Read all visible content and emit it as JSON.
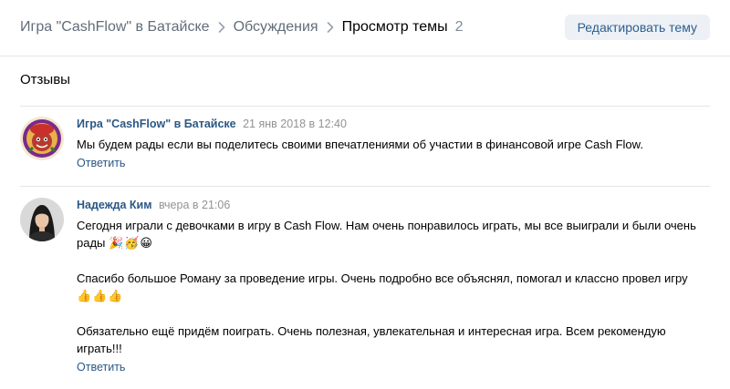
{
  "breadcrumb": {
    "group": "Игра \"CashFlow\" в Батайске",
    "section": "Обсуждения",
    "current": "Просмотр темы",
    "count": "2"
  },
  "header": {
    "edit_label": "Редактировать тему"
  },
  "topic": {
    "title": "Отзывы"
  },
  "posts": [
    {
      "author": "Игра \"CashFlow\" в Батайске",
      "date": "21 янв 2018 в 12:40",
      "paragraphs": [
        "Мы будем рады если вы поделитесь своими впечатлениями об участии в финансовой игре Cash Flow."
      ],
      "reply_label": "Ответить"
    },
    {
      "author": "Надежда Ким",
      "date": "вчера в 21:06",
      "paragraphs": [
        "Сегодня играли с девочками в игру в Cash Flow. Нам очень понравилось играть, мы все выиграли и были очень рады",
        "Спасибо большое Роману за проведение игры. Очень подробно все объяснял, помогал и классно провел игру",
        "Обязательно ещё придём поиграть. Очень полезная, увлекательная и интересная игра. Всем рекомендую играть!!!"
      ],
      "emoji": [
        "🎉🥳😀",
        "👍👍👍"
      ],
      "reply_label": "Ответить"
    }
  ],
  "colors": {
    "link": "#2a5885",
    "muted": "#939393",
    "button_bg": "#edf0f5",
    "divider": "#e3e5e8"
  }
}
